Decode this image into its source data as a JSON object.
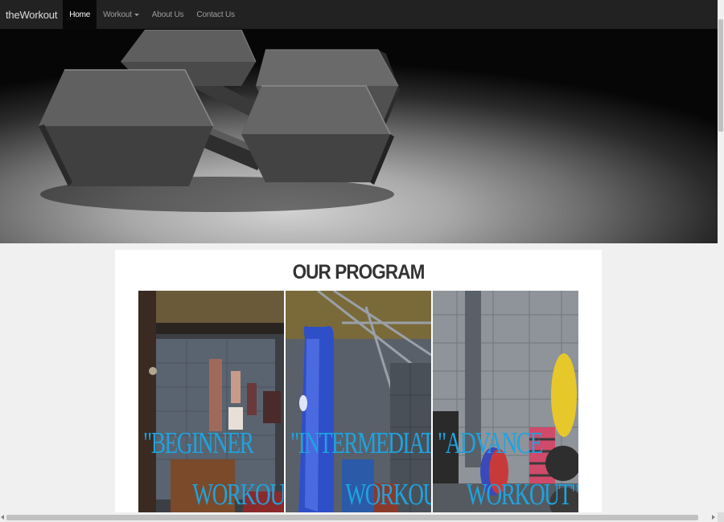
{
  "navbar": {
    "brand": "theWorkout",
    "items": [
      {
        "label": "Home",
        "active": true
      },
      {
        "label": "Workout",
        "dropdown": true
      },
      {
        "label": "About Us"
      },
      {
        "label": "Contact Us"
      }
    ]
  },
  "program": {
    "title": "OUR PROGRAM",
    "tiles": [
      {
        "line1": "\"BEGINNER",
        "line2": "WORKOUT\""
      },
      {
        "line1": "\"INTERMEDIATE",
        "line2": "WORKOUT\""
      },
      {
        "line1": "\"ADVANCE",
        "line2": "WORKOUT\""
      }
    ]
  },
  "colors": {
    "navbar_bg": "#222222",
    "nav_active_bg": "#080808",
    "tile_label": "#1fa3df"
  }
}
